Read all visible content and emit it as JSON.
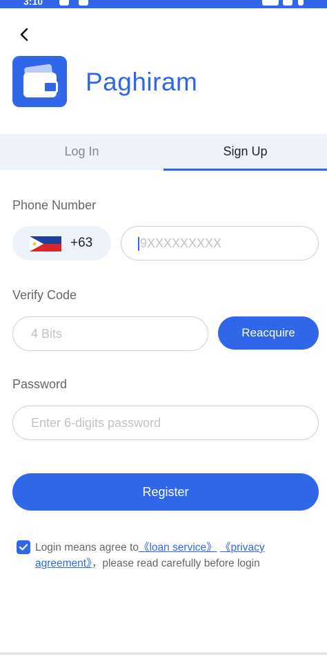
{
  "status": {
    "time": "3:10"
  },
  "app": {
    "name": "Paghiram"
  },
  "tabs": [
    {
      "label": "Log In"
    },
    {
      "label": "Sign Up"
    }
  ],
  "form": {
    "phone_label": "Phone Number",
    "country_code": "+63",
    "phone_placeholder": "9XXXXXXXXX",
    "verify_label": "Verify Code",
    "verify_placeholder": "4 Bits",
    "reacquire_label": "Reacquire",
    "password_label": "Password",
    "password_placeholder": "Enter 6-digits password",
    "register_label": "Register"
  },
  "agreement": {
    "prefix": "Login means agree to",
    "loan_link": "《loan service》",
    "privacy_link": "《privacy agreement》",
    "suffix": "，please read carefully before login",
    "checked": true
  },
  "colors": {
    "accent": "#2f67e8",
    "tab_bg": "#eef3fb"
  },
  "icons": {
    "back": "chevron-left-icon",
    "logo": "wallet-icon",
    "flag": "philippines-flag-icon",
    "check": "checkmark-icon"
  }
}
